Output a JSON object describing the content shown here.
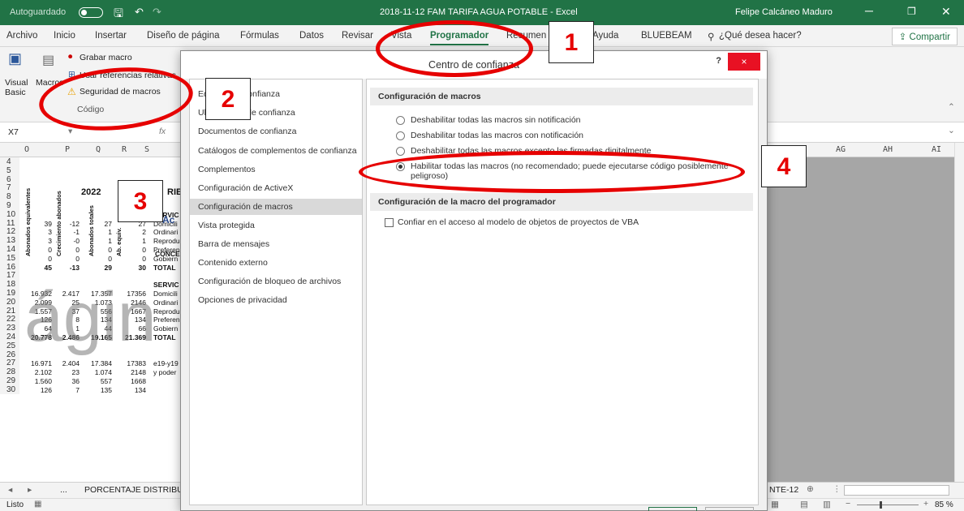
{
  "titlebar": {
    "autosave_label": "Autoguardado",
    "file_title": "2018-11-12 FAM TARIFA AGUA POTABLE - Excel",
    "user_name": "Felipe Calcáneo Maduro"
  },
  "ribbon_tabs": [
    "Archivo",
    "Inicio",
    "Insertar",
    "Diseño de página",
    "Fórmulas",
    "Datos",
    "Revisar",
    "Vista",
    "Programador",
    "Resumen Co",
    "Ayuda",
    "BLUEBEAM"
  ],
  "active_tab": "Programador",
  "tell_me": "¿Qué desea hacer?",
  "share_label": "Compartir",
  "ribbon": {
    "visual_basic": "Visual Basic",
    "macros": "Macros",
    "record_macro": "Grabar macro",
    "relative_refs": "Usar referencias relativas",
    "macro_security": "Seguridad de macros",
    "group_label": "Código"
  },
  "formula_bar": {
    "name_box": "X7",
    "fx": "fx"
  },
  "sheet": {
    "columns": [
      "O",
      "P",
      "Q",
      "R",
      "S"
    ],
    "right_columns": [
      "AG",
      "AH",
      "AI"
    ],
    "year": "2022",
    "header_cols": [
      "Abonados equivalentes",
      "Crecimiento abonados",
      "Abonados totales",
      "Ab. equiv."
    ],
    "concept_label": "CONCE",
    "watermark": "ágin",
    "rows": [
      {
        "n": "4",
        "v": []
      },
      {
        "n": "5",
        "v": []
      },
      {
        "n": "6",
        "v": []
      },
      {
        "n": "7",
        "v": []
      },
      {
        "n": "8",
        "v": []
      },
      {
        "n": "9",
        "v": []
      },
      {
        "n": "10",
        "v": []
      },
      {
        "n": "11",
        "v": [
          "39",
          "-12",
          "27",
          "27"
        ]
      },
      {
        "n": "12",
        "v": [
          "3",
          "-1",
          "1",
          "2"
        ]
      },
      {
        "n": "13",
        "v": [
          "3",
          "-0",
          "1",
          "1"
        ]
      },
      {
        "n": "14",
        "v": [
          "0",
          "0",
          "0",
          "0"
        ]
      },
      {
        "n": "15",
        "v": [
          "0",
          "0",
          "0",
          "0"
        ]
      },
      {
        "n": "16",
        "v": [
          "45",
          "-13",
          "29",
          "30"
        ]
      },
      {
        "n": "17",
        "v": []
      },
      {
        "n": "18",
        "v": []
      },
      {
        "n": "19",
        "v": [
          "16.932",
          "2.417",
          "17.357",
          "17356"
        ]
      },
      {
        "n": "20",
        "v": [
          "2.099",
          "25",
          "1.073",
          "2146"
        ]
      },
      {
        "n": "21",
        "v": [
          "1.557",
          "37",
          "556",
          "1667"
        ]
      },
      {
        "n": "22",
        "v": [
          "126",
          "8",
          "134",
          "134"
        ]
      },
      {
        "n": "23",
        "v": [
          "64",
          "1",
          "44",
          "66"
        ]
      },
      {
        "n": "24",
        "v": [
          "20.778",
          "2.486",
          "19.165",
          "21.369"
        ]
      },
      {
        "n": "25",
        "v": []
      },
      {
        "n": "26",
        "v": []
      },
      {
        "n": "27",
        "v": [
          "16.971",
          "2.404",
          "17.384",
          "17383"
        ]
      },
      {
        "n": "28",
        "v": [
          "2.102",
          "23",
          "1.074",
          "2148"
        ]
      },
      {
        "n": "29",
        "v": [
          "1.560",
          "36",
          "557",
          "1668"
        ]
      },
      {
        "n": "30",
        "v": [
          "126",
          "7",
          "135",
          "134"
        ]
      }
    ],
    "concept_rows": {
      "servic_a": "SERVIC",
      "items_a": [
        "Domicili",
        "Ordinari",
        "Reprodu",
        "Preferen",
        "Gobiern"
      ],
      "total_a": "TOTAL",
      "servic_b": "SERVIC",
      "items_b": [
        "Domicili",
        "Ordinari",
        "Reprodu",
        "Preferen",
        "Gobiern"
      ],
      "total_b": "TOTAL",
      "note_1": "e19-y19",
      "note_2": "y poder",
      "ries": "RIE",
      "ac": "Ac"
    }
  },
  "sheet_tabs": {
    "visible": "PORCENTAJE DISTRIBU",
    "right": "NTE-12",
    "more": "..."
  },
  "status": {
    "ready": "Listo",
    "zoom": "85 %"
  },
  "dialog": {
    "title": "Centro de confianza",
    "help": "?",
    "close": "×",
    "nav": [
      "Editores de confianza",
      "Ubicaciones de confianza",
      "Documentos de confianza",
      "Catálogos de complementos de confianza",
      "Complementos",
      "Configuración de ActiveX",
      "Configuración de macros",
      "Vista protegida",
      "Barra de mensajes",
      "Contenido externo",
      "Configuración de bloqueo de archivos",
      "Opciones de privacidad"
    ],
    "nav_selected": "Configuración de macros",
    "macro_section": "Configuración de macros",
    "options": [
      "Deshabilitar todas las macros sin notificación",
      "Deshabilitar todas las macros con notificación",
      "Deshabilitar todas las macros excepto las firmadas digitalmente",
      "Habilitar todas las macros (no recomendado; puede ejecutarse código posiblemente peligroso)"
    ],
    "selected_option": 3,
    "dev_section": "Configuración de la macro del programador",
    "vba_checkbox": "Confiar en el acceso al modelo de objetos de proyectos de VBA"
  },
  "annotations": [
    "1",
    "2",
    "3",
    "4"
  ],
  "colors": {
    "excel_green": "#217346",
    "annotation_red": "#e60000",
    "close_red": "#e81123"
  }
}
